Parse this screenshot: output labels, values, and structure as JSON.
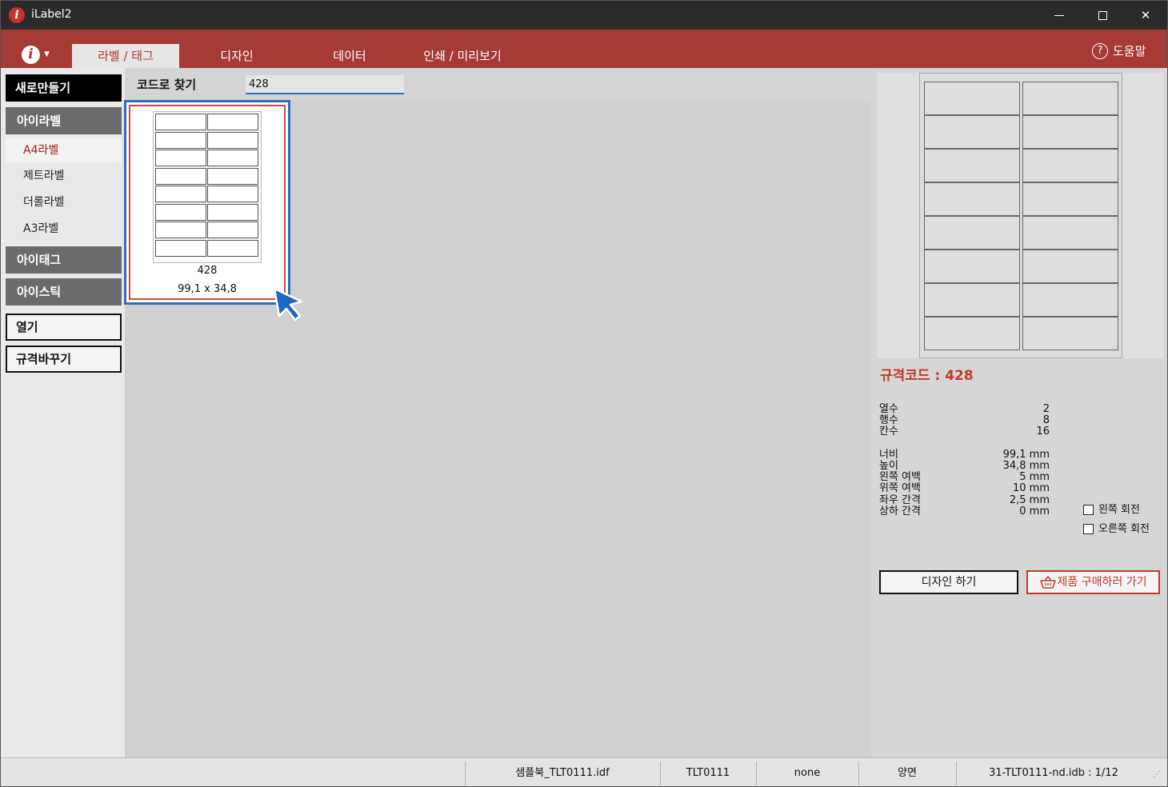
{
  "window": {
    "title": "iLabel2"
  },
  "ribbon": {
    "tabs": [
      {
        "label": "라벨 / 태그",
        "active": true
      },
      {
        "label": "디자인"
      },
      {
        "label": "데이터"
      },
      {
        "label": "인쇄 / 미리보기"
      }
    ],
    "help_label": "도움말"
  },
  "sidebar": {
    "new_label": "새로만들기",
    "group_label": "아이라벨",
    "sub_items": [
      "A4라벨",
      "제트라벨",
      "더롤라벨",
      "A3라벨"
    ],
    "selected_sub": "A4라벨",
    "tag_label": "아이태그",
    "sticker_label": "아이스틱",
    "open_label": "열기",
    "change_spec_label": "규격바꾸기"
  },
  "search": {
    "label": "코드로 찾기",
    "value": "428"
  },
  "label_card": {
    "code": "428",
    "size": "99,1 x 34,8",
    "columns": 2,
    "rows": 8
  },
  "spec": {
    "code_text": "규격코드 : 428",
    "counts": [
      {
        "label": "열수",
        "value": "2"
      },
      {
        "label": "행수",
        "value": "8"
      },
      {
        "label": "칸수",
        "value": "16"
      }
    ],
    "dims": [
      {
        "label": "너비",
        "value": "99,1 mm"
      },
      {
        "label": "높이",
        "value": "34,8 mm"
      },
      {
        "label": "왼쪽 여백",
        "value": "5 mm"
      },
      {
        "label": "위쪽 여백",
        "value": "10 mm"
      },
      {
        "label": "좌우 간격",
        "value": "2,5 mm"
      },
      {
        "label": "상하 간격",
        "value": "0 mm"
      }
    ],
    "rotate_left": "왼쪽 회전",
    "rotate_right": "오른쪽 회전",
    "design_button": "디자인 하기",
    "buy_button": "제품 구매하러 가기"
  },
  "status": {
    "file": "샘플북_TLT0111.idf",
    "code": "TLT0111",
    "option": "none",
    "side": "양면",
    "db": "31-TLT0111-nd.idb : 1/12"
  },
  "colors": {
    "accent": "#a63a34",
    "highlight": "#2a6fbd",
    "titlebar": "#2b2b2b"
  }
}
